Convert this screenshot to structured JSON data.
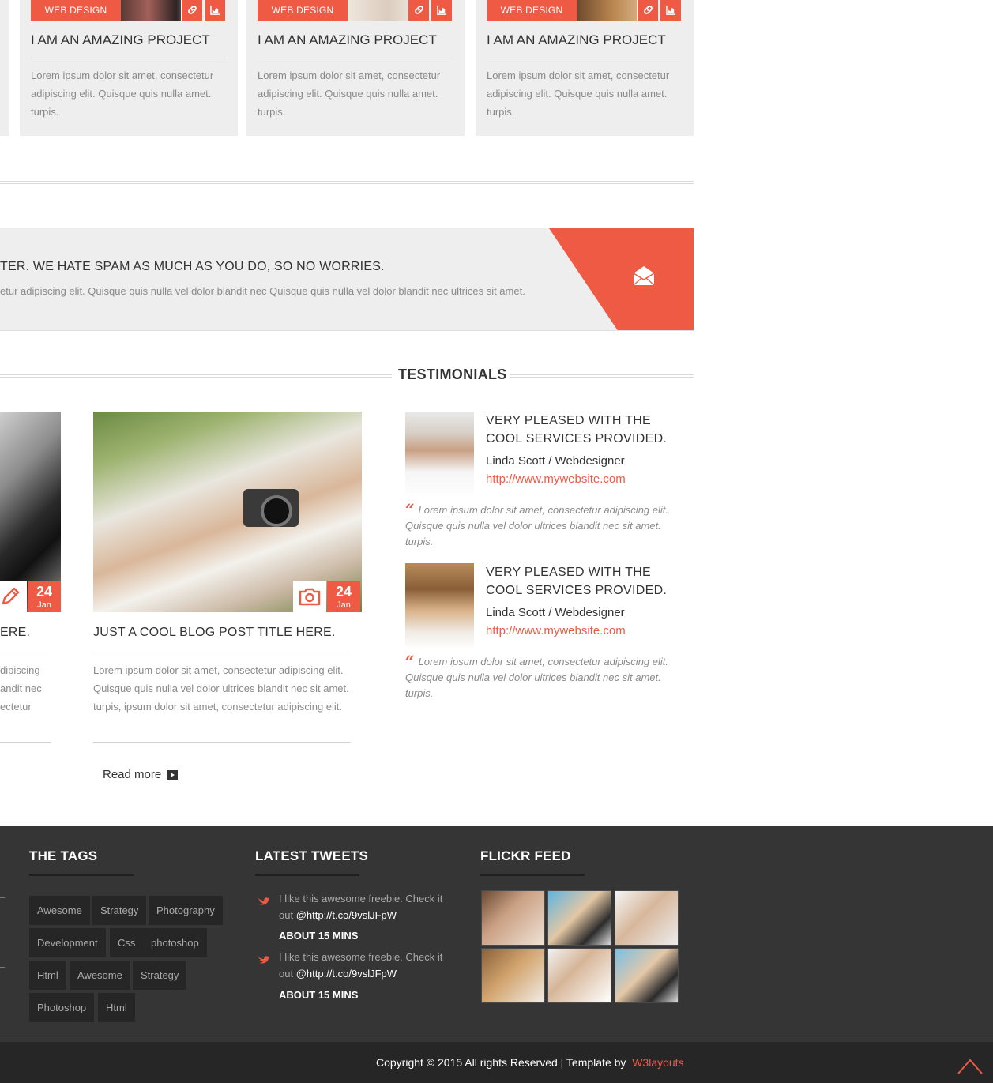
{
  "colors": {
    "accent": "#ee5a44",
    "card_bg": "#eeeeee",
    "footer_bg": "#353535",
    "bottom_bar_bg": "#262626"
  },
  "projects": [
    {
      "badge": "WEB DESIGN",
      "title": "I AM AN AMAZING PROJECT",
      "text": "Lorem ipsum dolor sit amet, consectetur adipiscing elit. Quisque quis nulla amet. turpis.",
      "icons": [
        "link-icon",
        "chart-icon"
      ]
    },
    {
      "badge": "WEB DESIGN",
      "title": "I AM AN AMAZING PROJECT",
      "text": "Lorem ipsum dolor sit amet, consectetur adipiscing elit. Quisque quis nulla amet. turpis.",
      "icons": [
        "link-icon",
        "chart-icon"
      ]
    },
    {
      "badge": "WEB DESIGN",
      "title": "I AM AN AMAZING PROJECT",
      "text": "Lorem ipsum dolor sit amet, consectetur adipiscing elit. Quisque quis nulla amet. turpis.",
      "icons": [
        "link-icon",
        "chart-icon"
      ]
    }
  ],
  "newsletter": {
    "heading": "TER. WE HATE SPAM AS MUCH AS YOU DO, SO NO WORRIES.",
    "sub": "etur adipiscing elit. Quisque quis nulla vel dolor blandit nec Quisque quis nulla vel dolor blandit nec ultrices sit amet.",
    "icon": "envelope-icon"
  },
  "testimonials_heading": "TESTIMONIALS",
  "posts": [
    {
      "title": "ERE.",
      "date_day": "24",
      "date_month": "Jan",
      "type_icon": "pencil-icon",
      "text_lines": [
        "dipiscing",
        "andit nec",
        "ectetur"
      ]
    },
    {
      "title": "JUST A COOL BLOG POST TITLE HERE.",
      "date_day": "24",
      "date_month": "Jan",
      "type_icon": "camera-icon",
      "text": "Lorem ipsum dolor sit amet, consectetur adipiscing elit. Quisque quis nulla vel dolor ultrices blandit nec sit amet. turpis, ipsum dolor sit amet, consectetur adipiscing elit."
    }
  ],
  "read_more": "Read more",
  "testimonials": [
    {
      "title": "VERY PLEASED WITH THE COOL SERVICES PROVIDED.",
      "name": "Linda Scott / Webdesigner",
      "link": "http://www.mywebsite.com",
      "quote": "Lorem ipsum dolor sit amet, consectetur adipiscing elit. Quisque quis nulla vel dolor ultrices blandit nec sit amet. turpis."
    },
    {
      "title": "VERY PLEASED WITH THE COOL SERVICES PROVIDED.",
      "name": "Linda Scott / Webdesigner",
      "link": "http://www.mywebsite.com",
      "quote": "Lorem ipsum dolor sit amet, consectetur adipiscing elit. Quisque quis nulla vel dolor ultrices blandit nec sit amet. turpis."
    }
  ],
  "footer": {
    "tags_heading": "THE TAGS",
    "tags": [
      "Awesome",
      "Strategy",
      "Photography",
      "Development",
      "Css",
      "photoshop",
      "Html",
      "Awesome",
      "Strategy",
      "Photoshop",
      "Html"
    ],
    "tweets_heading": "LATEST TWEETS",
    "tweets": [
      {
        "text": "I like this awesome freebie. Check it out",
        "handle": "@http://t.co/9vslJFpW",
        "time": "ABOUT 15 MINS"
      },
      {
        "text": "I like this awesome freebie. Check it out",
        "handle": "@http://t.co/9vslJFpW",
        "time": "ABOUT 15 MINS"
      }
    ],
    "flickr_heading": "FLICKR FEED",
    "copyright": "Copyright © 2015 All rights Reserved | Template by",
    "copyright_brand": "W3layouts"
  }
}
